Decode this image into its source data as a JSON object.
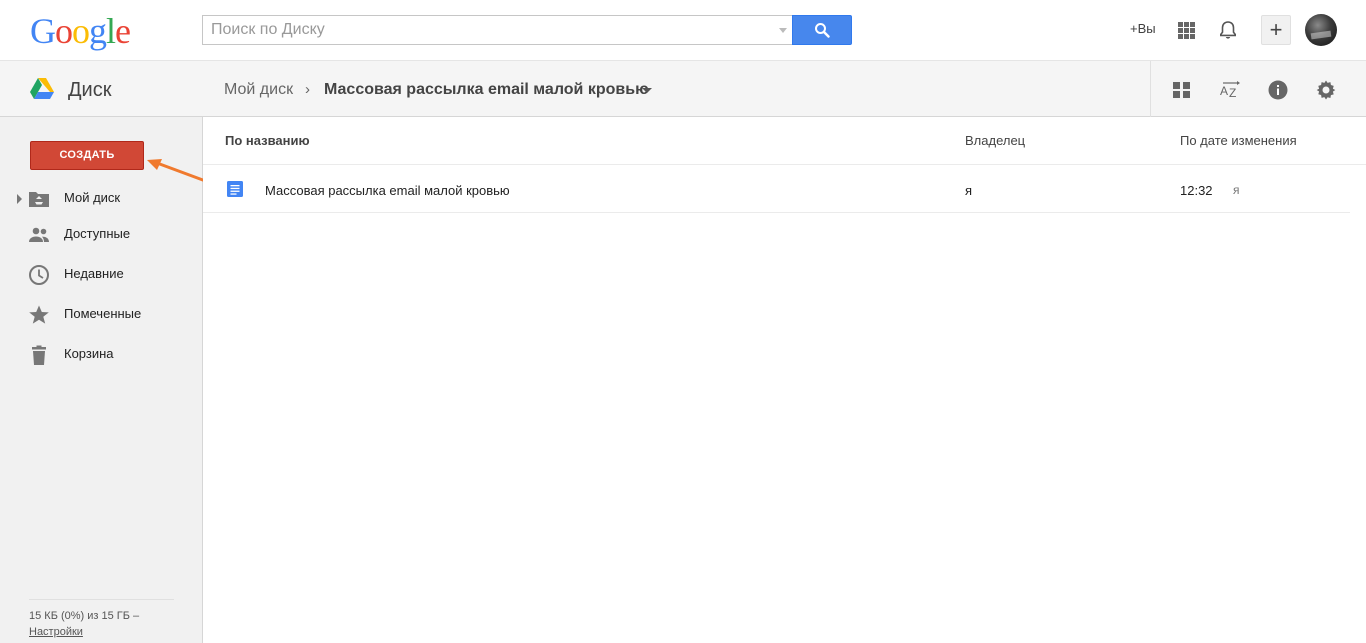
{
  "header": {
    "logo_letters": [
      "G",
      "o",
      "o",
      "g",
      "l",
      "e"
    ],
    "search_placeholder": "Поиск по Диску",
    "plus_you": "+Вы",
    "share_label": "+"
  },
  "subheader": {
    "app_title": "Диск",
    "breadcrumb_root": "Мой диск",
    "breadcrumb_sep": "›",
    "breadcrumb_current": "Массовая рассылка email малой кровью"
  },
  "sidebar": {
    "create_label": "СОЗДАТЬ",
    "items": [
      {
        "label": "Мой диск",
        "icon": "drive-folder-icon"
      },
      {
        "label": "Доступные",
        "icon": "shared-people-icon"
      },
      {
        "label": "Недавние",
        "icon": "clock-icon"
      },
      {
        "label": "Помеченные",
        "icon": "star-icon"
      },
      {
        "label": "Корзина",
        "icon": "trash-icon"
      }
    ],
    "storage_text": "15 КБ (0%) из 15 ГБ –",
    "storage_link": "Настройки"
  },
  "list": {
    "columns": {
      "name": "По названию",
      "owner": "Владелец",
      "date": "По дате изменения"
    },
    "rows": [
      {
        "name": "Массовая рассылка email малой кровью",
        "owner": "я",
        "time": "12:32",
        "modifier": "я"
      }
    ]
  },
  "colors": {
    "create_button": "#d14836",
    "search_button": "#4787ed",
    "annotation_arrow": "#f07a2e"
  }
}
